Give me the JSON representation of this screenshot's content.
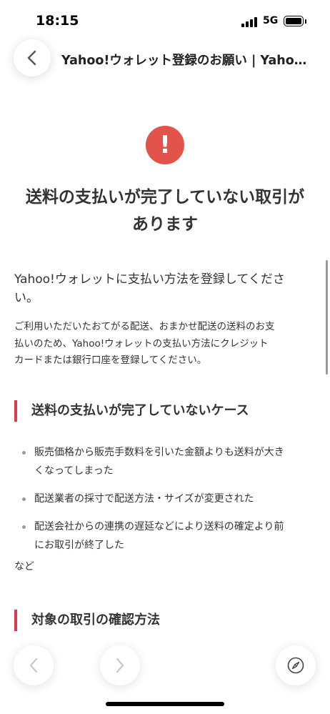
{
  "status_bar": {
    "time": "18:15",
    "network": "5G"
  },
  "header": {
    "title": "Yahoo!ウォレット登録のお願い | Yahoo!フリマ"
  },
  "main": {
    "title_line1": "送料の支払いが完了していない取引が",
    "title_line2": "あります",
    "lead_line1": "Yahoo!ウォレットに支払い方法を登録してくださ",
    "lead_line2": "い。",
    "desc_line1": "ご利用いただいたおてがる配送、おまかせ配送の送料のお支",
    "desc_line2": "払いのため、Yahoo!ウォレットの支払い方法にクレジット",
    "desc_line3": "カードまたは銀行口座を登録してください。"
  },
  "section1": {
    "heading": "送料の支払いが完了していないケース",
    "items": [
      {
        "line1": "販売価格から販売手数料を引いた金額よりも送料が大き",
        "line2": "くなってしまった"
      },
      {
        "line1": "配送業者の採寸で配送方法・サイズが変更された",
        "line2": ""
      },
      {
        "line1": "配送会社からの連携の遅延などにより送料の確定より前",
        "line2": "にお取引が終了した"
      }
    ],
    "footer": "など"
  },
  "section2": {
    "heading": "対象の取引の確認方法"
  },
  "colors": {
    "alert": "#e2534c",
    "accent_bar": "#e03a53"
  },
  "icons": {
    "back": "chevron-left-icon",
    "alert": "exclamation-icon",
    "prev": "chevron-left-icon",
    "next": "chevron-right-icon",
    "compass": "compass-icon"
  }
}
